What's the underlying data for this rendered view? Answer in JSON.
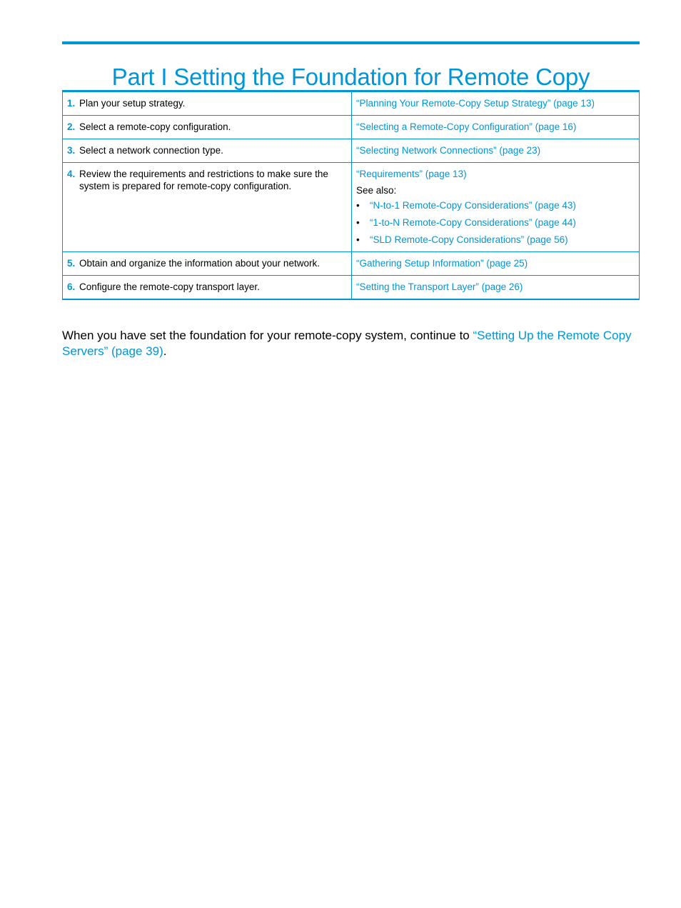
{
  "page": {
    "title": "Part I Setting the Foundation for Remote Copy",
    "accent_color": "#0096d6"
  },
  "steps": [
    {
      "num": "1.",
      "text": "Plan your setup strategy.",
      "link": "“Planning Your Remote-Copy Setup Strategy” (page 13)"
    },
    {
      "num": "2.",
      "text": "Select a remote-copy configuration.",
      "link": "“Selecting a Remote-Copy Configuration” (page 16)"
    },
    {
      "num": "3.",
      "text": "Select a network connection type.",
      "link": "“Selecting Network Connections” (page 23)"
    },
    {
      "num": "4.",
      "text": "Review the requirements and restrictions to make sure the system is prepared for remote-copy configuration.",
      "link": "“Requirements” (page 13)",
      "see_also_label": "See also:",
      "see_also": [
        "“N-to-1 Remote-Copy Considerations” (page 43)",
        "“1-to-N Remote-Copy Considerations” (page 44)",
        "“SLD Remote-Copy Considerations” (page 56)"
      ]
    },
    {
      "num": "5.",
      "text": "Obtain and organize the information about your network.",
      "link": "“Gathering Setup Information” (page 25)"
    },
    {
      "num": "6.",
      "text": "Configure the remote-copy transport layer.",
      "link": "“Setting the Transport Layer” (page 26)"
    }
  ],
  "closing": {
    "text": "When you have set the foundation for your remote-copy system, continue to ",
    "link": "“Setting Up the Remote Copy Servers” (page 39)",
    "end": "."
  }
}
